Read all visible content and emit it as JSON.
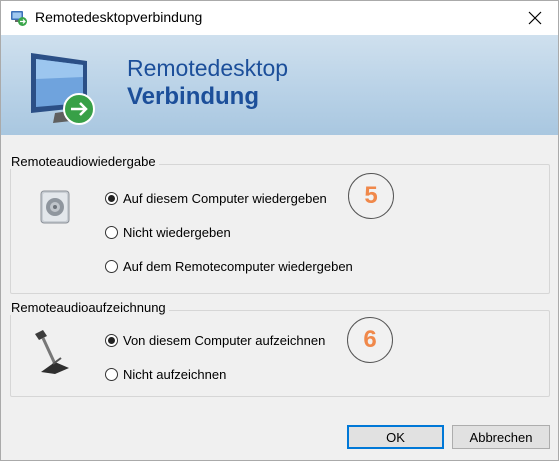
{
  "window": {
    "title": "Remotedesktopverbindung"
  },
  "banner": {
    "line1": "Remotedesktop",
    "line2": "Verbindung"
  },
  "playback": {
    "legend": "Remoteaudiowiedergabe",
    "options": [
      {
        "label": "Auf diesem Computer wiedergeben",
        "checked": true
      },
      {
        "label": "Nicht wiedergeben",
        "checked": false
      },
      {
        "label": "Auf dem Remotecomputer wiedergeben",
        "checked": false
      }
    ],
    "marker": "5"
  },
  "recording": {
    "legend": "Remoteaudioaufzeichnung",
    "options": [
      {
        "label": "Von diesem Computer aufzeichnen",
        "checked": true
      },
      {
        "label": "Nicht aufzeichnen",
        "checked": false
      }
    ],
    "marker": "6"
  },
  "buttons": {
    "ok": "OK",
    "cancel": "Abbrechen"
  },
  "icons": {
    "title": "remote-desktop-icon",
    "close": "close-icon",
    "banner": "monitor-icon",
    "playback": "speaker-icon",
    "recording": "microphone-icon"
  },
  "colors": {
    "banner_text": "#1c4f9a",
    "marker_number": "#f0884a",
    "default_button_border": "#0078d7"
  }
}
